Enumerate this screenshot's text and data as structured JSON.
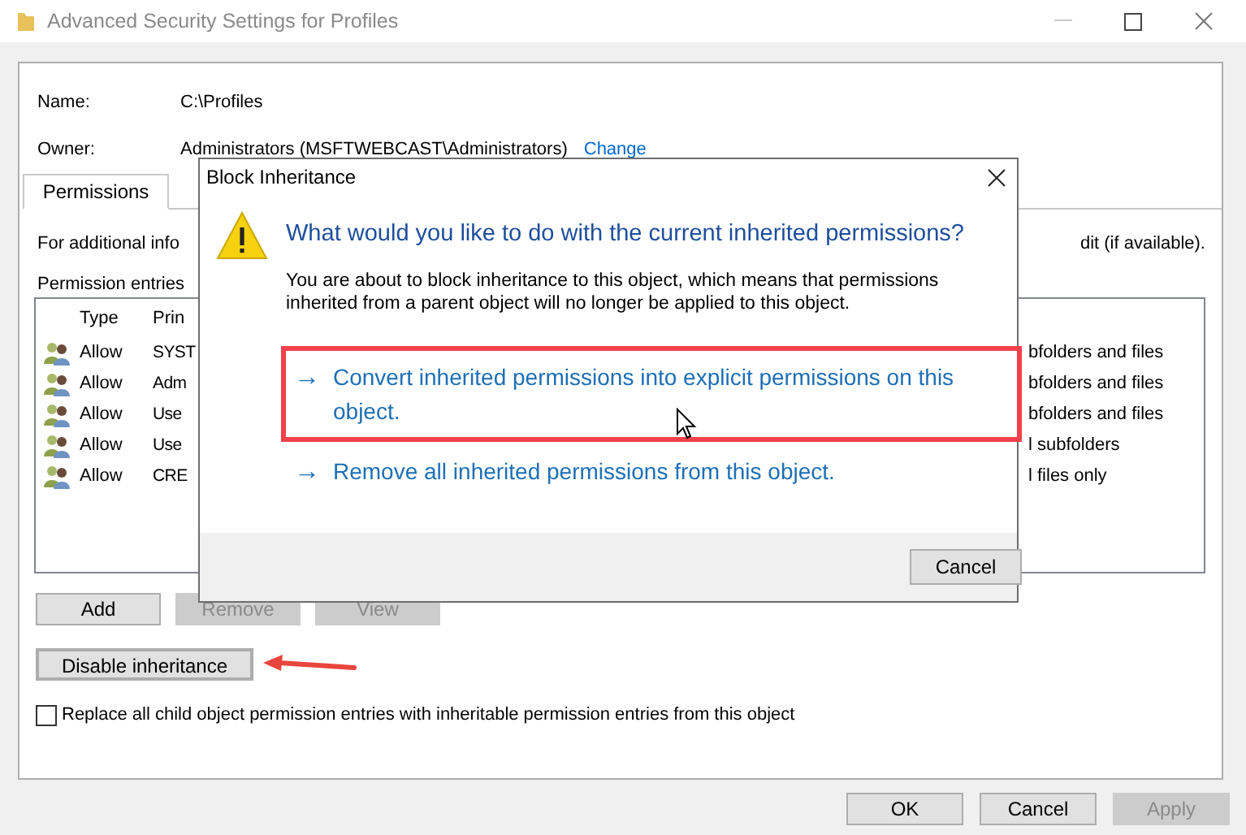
{
  "window": {
    "title": "Advanced Security Settings for Profiles"
  },
  "name": {
    "label": "Name:",
    "value": "C:\\Profiles"
  },
  "owner": {
    "label": "Owner:",
    "value": "Administrators (MSFTWEBCAST\\Administrators)",
    "link": "Change"
  },
  "tabs": [
    {
      "label": "Permissions",
      "selected": true
    }
  ],
  "info_text": {
    "start": "For additional info",
    "end": "dit (if available)."
  },
  "entries_label": "Permission entries",
  "list": {
    "columns": [
      "Type",
      "Prin"
    ],
    "rows": [
      {
        "type": "Allow",
        "principal": "SYST",
        "applies_to": "bfolders and files"
      },
      {
        "type": "Allow",
        "principal": "Adm",
        "applies_to": "bfolders and files"
      },
      {
        "type": "Allow",
        "principal": "Use",
        "applies_to": "bfolders and files"
      },
      {
        "type": "Allow",
        "principal": "Use",
        "applies_to": "l subfolders"
      },
      {
        "type": "Allow",
        "principal": "CRE",
        "applies_to": "l files only"
      }
    ]
  },
  "entry_buttons": [
    {
      "label": "Add",
      "disabled": false
    },
    {
      "label": "Remove",
      "disabled": true
    },
    {
      "label": "View",
      "disabled": true
    }
  ],
  "disable_inheritance": {
    "label": "Disable inheritance",
    "focused": true
  },
  "replace_checkbox": {
    "label": "Replace all child object permission entries with inheritable permission entries from this object",
    "checked": false
  },
  "footer_buttons": [
    {
      "label": "OK",
      "disabled": false
    },
    {
      "label": "Cancel",
      "disabled": false
    },
    {
      "label": "Apply",
      "disabled": true
    }
  ],
  "dialog": {
    "title": "Block Inheritance",
    "heading": "What would you like to do with the current inherited permissions?",
    "message": "You are about to block inheritance to this object, which means that permissions inherited from a parent object will no longer be applied to this object.",
    "options": [
      {
        "arrow": "→",
        "label": "Convert inherited permissions into explicit permissions on this object.",
        "highlighted": true
      },
      {
        "arrow": "→",
        "label": "Remove all inherited permissions from this object.",
        "highlighted": false
      }
    ],
    "cancel": "Cancel"
  }
}
